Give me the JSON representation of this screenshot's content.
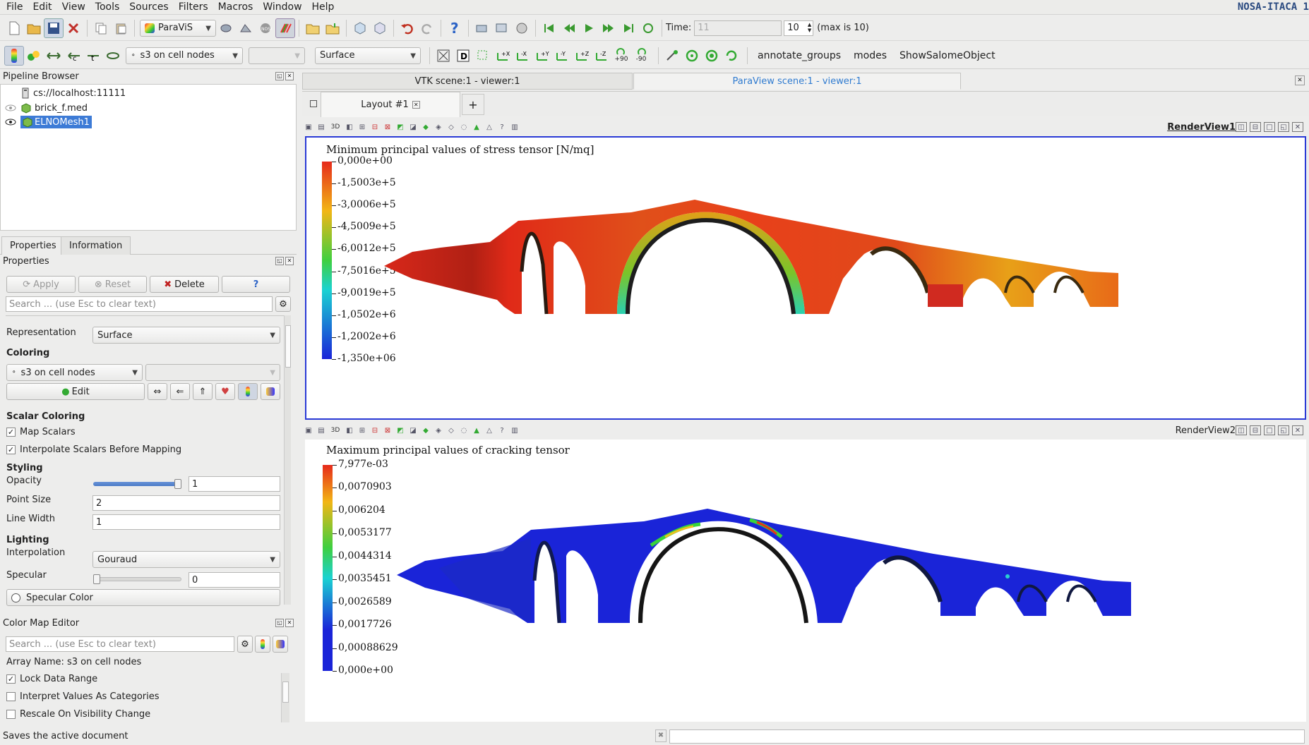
{
  "menu": [
    "File",
    "Edit",
    "View",
    "Tools",
    "Sources",
    "Filters",
    "Macros",
    "Window",
    "Help"
  ],
  "brand": "NOSA-ITACA 1",
  "toolbar1": {
    "module": "ParaViS",
    "time_label": "Time:",
    "time_value": "11",
    "time_index": "10",
    "time_max": "(max is 10)"
  },
  "toolbar2": {
    "color_array": "s3 on cell nodes",
    "component": "",
    "representation": "Surface",
    "rot_plus": "+90",
    "rot_minus": "-90",
    "macros": [
      "annotate_groups",
      "modes",
      "ShowSalomeObject"
    ]
  },
  "pipeline": {
    "title": "Pipeline Browser",
    "items": [
      "cs://localhost:11111",
      "brick_f.med",
      "ELNOMesh1"
    ]
  },
  "tabs": [
    "Properties",
    "Information"
  ],
  "properties": {
    "title": "Properties",
    "apply": "Apply",
    "reset": "Reset",
    "delete": "Delete",
    "help": "?",
    "search_placeholder": "Search ... (use Esc to clear text)",
    "representation_label": "Representation",
    "representation_value": "Surface",
    "coloring_title": "Coloring",
    "color_array": "s3 on cell nodes",
    "edit_label": "Edit",
    "scalar_title": "Scalar Coloring",
    "map_scalars": "Map Scalars",
    "interp_scalars": "Interpolate Scalars Before Mapping",
    "styling_title": "Styling",
    "opacity_label": "Opacity",
    "opacity_value": "1",
    "point_size_label": "Point Size",
    "point_size_value": "2",
    "line_width_label": "Line Width",
    "line_width_value": "1",
    "lighting_title": "Lighting",
    "interpolation_label": "Interpolation",
    "interpolation_value": "Gouraud",
    "specular_label": "Specular",
    "specular_value": "0",
    "specular_color": "Specular Color"
  },
  "colormap": {
    "title": "Color Map Editor",
    "search_placeholder": "Search ... (use Esc to clear text)",
    "array_name": "Array Name: s3 on cell nodes",
    "lock": "Lock Data Range",
    "categories": "Interpret Values As Categories",
    "rescale": "Rescale On Visibility Change"
  },
  "status": "Saves the active document",
  "views": {
    "tabs": [
      "VTK scene:1 - viewer:1",
      "ParaView scene:1 - viewer:1"
    ],
    "layout_tab": "Layout #1",
    "add_tab": "+",
    "rv1": "RenderView1",
    "rv2": "RenderView2",
    "label_3d": "3D",
    "title1": "Minimum principal values of stress tensor [N/mq]",
    "ticks1": [
      "0,000e+00",
      "-1,5003e+5",
      "-3,0006e+5",
      "-4,5009e+5",
      "-6,0012e+5",
      "-7,5016e+5",
      "-9,0019e+5",
      "-1,0502e+6",
      "-1,2002e+6",
      "-1,350e+06"
    ],
    "title2": "Maximum principal values of cracking tensor",
    "ticks2": [
      "7,977e-03",
      "0,0070903",
      "0,006204",
      "0,0053177",
      "0,0044314",
      "0,0035451",
      "0,0026589",
      "0,0017726",
      "0,00088629",
      "0,000e+00"
    ]
  },
  "colors": {
    "accent": "#2f6bd0",
    "selected": "#3d7bd6",
    "red": "#e6251b",
    "blue": "#1a24d8"
  }
}
